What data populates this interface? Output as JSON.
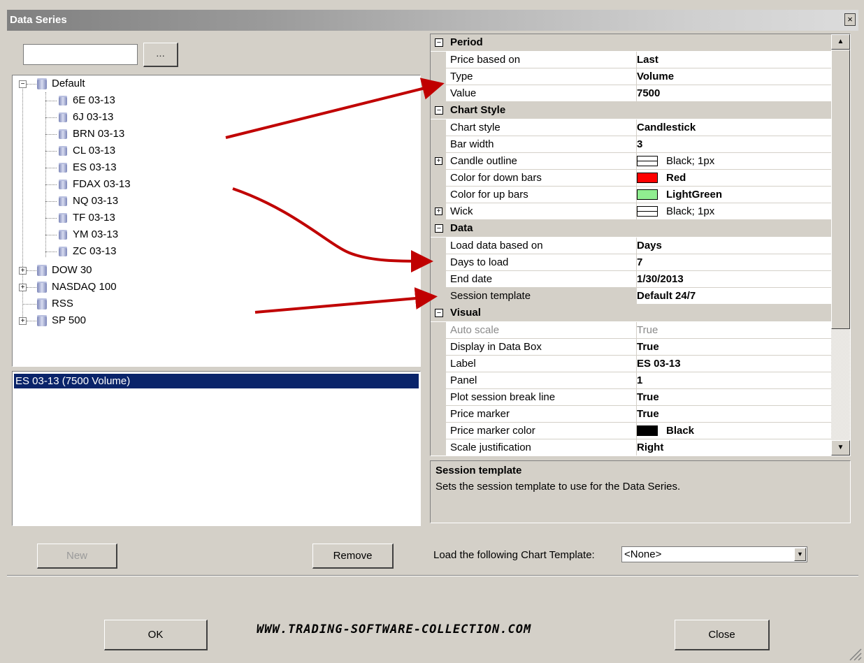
{
  "window": {
    "title": "Data Series",
    "close_glyph": "×"
  },
  "left_panel": {
    "filter_value": "",
    "browse_label": "...",
    "tree": {
      "default_group": "Default",
      "default_children": [
        "6E 03-13",
        "6J 03-13",
        "BRN 03-13",
        "CL 03-13",
        "ES 03-13",
        "FDAX 03-13",
        "NQ 03-13",
        "TF 03-13",
        "YM 03-13",
        "ZC 03-13"
      ],
      "other_groups": [
        "DOW 30",
        "NASDAQ 100",
        "RSS",
        "SP 500"
      ]
    },
    "selected_series": "ES 03-13 (7500 Volume)",
    "new_label": "New",
    "remove_label": "Remove"
  },
  "properties": {
    "period": {
      "title": "Period",
      "price_based_on": {
        "label": "Price based on",
        "value": "Last"
      },
      "type": {
        "label": "Type",
        "value": "Volume"
      },
      "value": {
        "label": "Value",
        "value": "7500"
      }
    },
    "chart_style": {
      "title": "Chart Style",
      "chart_style": {
        "label": "Chart style",
        "value": "Candlestick"
      },
      "bar_width": {
        "label": "Bar width",
        "value": "3"
      },
      "candle_outline": {
        "label": "Candle outline",
        "value": "Black; 1px"
      },
      "down_bars": {
        "label": "Color for down bars",
        "value": "Red",
        "color": "#ff0000"
      },
      "up_bars": {
        "label": "Color for up bars",
        "value": "LightGreen",
        "color": "#90ee90"
      },
      "wick": {
        "label": "Wick",
        "value": "Black; 1px"
      }
    },
    "data": {
      "title": "Data",
      "load_based_on": {
        "label": "Load data based on",
        "value": "Days"
      },
      "days_to_load": {
        "label": "Days to load",
        "value": "7"
      },
      "end_date": {
        "label": "End date",
        "value": "1/30/2013"
      },
      "session_template": {
        "label": "Session template",
        "value": "Default 24/7"
      }
    },
    "visual": {
      "title": "Visual",
      "auto_scale": {
        "label": "Auto scale",
        "value": "True"
      },
      "display_in_data_box": {
        "label": "Display in Data Box",
        "value": "True"
      },
      "label": {
        "label": "Label",
        "value": "ES 03-13"
      },
      "panel": {
        "label": "Panel",
        "value": "1"
      },
      "plot_session_break": {
        "label": "Plot session break line",
        "value": "True"
      },
      "price_marker": {
        "label": "Price marker",
        "value": "True"
      },
      "price_marker_color": {
        "label": "Price marker color",
        "value": "Black",
        "color": "#000000"
      },
      "scale_justification": {
        "label": "Scale justification",
        "value": "Right"
      }
    },
    "scroll_up_glyph": "▲",
    "scroll_down_glyph": "▼"
  },
  "description": {
    "title": "Session template",
    "text": "Sets the session template to use for the Data Series."
  },
  "template": {
    "label": "Load the following Chart Template:",
    "value": "<None>",
    "arrow_glyph": "▼"
  },
  "footer": {
    "ok_label": "OK",
    "close_label": "Close",
    "watermark": "WWW.TRADING-SOFTWARE-COLLECTION.COM"
  },
  "colors": {
    "arrow": "#c00000",
    "selection": "#0a246a",
    "face": "#d4d0c8"
  }
}
